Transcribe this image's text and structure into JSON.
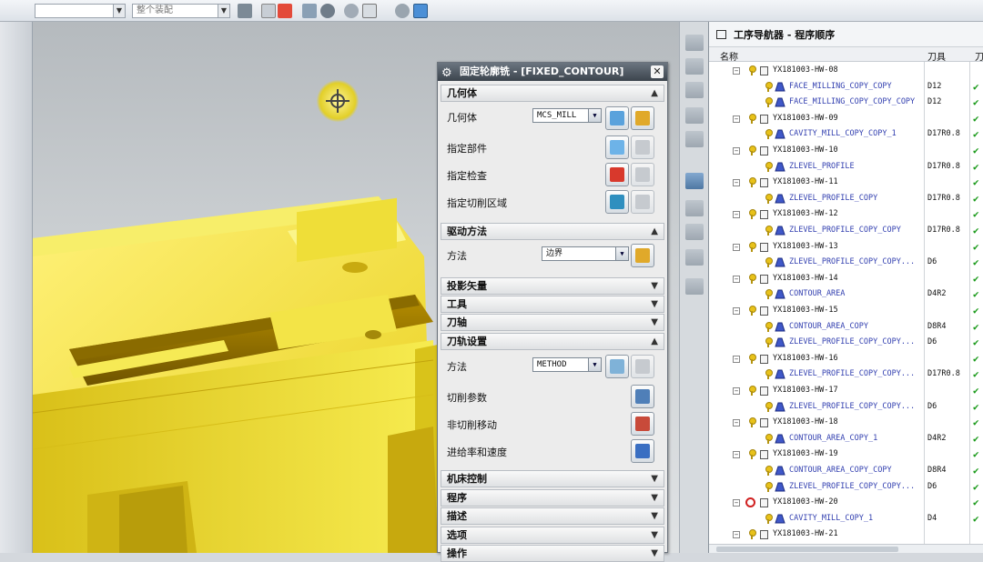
{
  "toolbar": {
    "select1": "",
    "select2": "整个装配"
  },
  "dialog": {
    "title": "固定轮廓铣 - [FIXED_CONTOUR]",
    "sections": {
      "geometry": "几何体",
      "drive": "驱动方法",
      "projection": "投影矢量",
      "tool": "工具",
      "axis": "刀轴",
      "path": "刀轨设置",
      "machine": "机床控制",
      "program": "程序",
      "description": "描述",
      "options": "选项",
      "actions": "操作"
    },
    "geometry_label": "几何体",
    "geometry_value": "MCS_MILL",
    "specify_part": "指定部件",
    "specify_check": "指定检查",
    "specify_cut_area": "指定切削区域",
    "method_label": "方法",
    "drive_method_value": "边界",
    "path_method_label": "方法",
    "path_method_value": "METHOD",
    "cut_params": "切削参数",
    "non_cut_moves": "非切削移动",
    "feeds_speeds": "进给率和速度"
  },
  "navigator": {
    "title": "工序导航器 - 程序顺序",
    "col_name": "名称",
    "col_tool": "刀具",
    "col_extra": "刀",
    "rows": [
      {
        "kind": "group",
        "label": "YX181003-HW-08",
        "tool": "",
        "check": ""
      },
      {
        "kind": "op",
        "label": "FACE_MILLING_COPY_COPY",
        "tool": "D12",
        "check": "✔"
      },
      {
        "kind": "op",
        "label": "FACE_MILLING_COPY_COPY_COPY",
        "tool": "D12",
        "check": "✔"
      },
      {
        "kind": "group",
        "label": "YX181003-HW-09",
        "tool": "",
        "check": "✔"
      },
      {
        "kind": "op",
        "label": "CAVITY_MILL_COPY_COPY_1",
        "tool": "D17R0.8",
        "check": "✔"
      },
      {
        "kind": "group",
        "label": "YX181003-HW-10",
        "tool": "",
        "check": "✔"
      },
      {
        "kind": "op",
        "label": "ZLEVEL_PROFILE",
        "tool": "D17R0.8",
        "check": "✔"
      },
      {
        "kind": "group",
        "label": "YX181003-HW-11",
        "tool": "",
        "check": "✔"
      },
      {
        "kind": "op",
        "label": "ZLEVEL_PROFILE_COPY",
        "tool": "D17R0.8",
        "check": "✔"
      },
      {
        "kind": "group",
        "label": "YX181003-HW-12",
        "tool": "",
        "check": "✔"
      },
      {
        "kind": "op",
        "label": "ZLEVEL_PROFILE_COPY_COPY",
        "tool": "D17R0.8",
        "check": "✔"
      },
      {
        "kind": "group",
        "label": "YX181003-HW-13",
        "tool": "",
        "check": "✔"
      },
      {
        "kind": "op",
        "label": "ZLEVEL_PROFILE_COPY_COPY...",
        "tool": "D6",
        "check": "✔"
      },
      {
        "kind": "group",
        "label": "YX181003-HW-14",
        "tool": "",
        "check": "✔"
      },
      {
        "kind": "op",
        "label": "CONTOUR_AREA",
        "tool": "D4R2",
        "check": "✔"
      },
      {
        "kind": "group",
        "label": "YX181003-HW-15",
        "tool": "",
        "check": "✔"
      },
      {
        "kind": "op",
        "label": "CONTOUR_AREA_COPY",
        "tool": "D8R4",
        "check": "✔"
      },
      {
        "kind": "op",
        "label": "ZLEVEL_PROFILE_COPY_COPY...",
        "tool": "D6",
        "check": "✔"
      },
      {
        "kind": "group",
        "label": "YX181003-HW-16",
        "tool": "",
        "check": "✔"
      },
      {
        "kind": "op",
        "label": "ZLEVEL_PROFILE_COPY_COPY...",
        "tool": "D17R0.8",
        "check": "✔"
      },
      {
        "kind": "group",
        "label": "YX181003-HW-17",
        "tool": "",
        "check": "✔"
      },
      {
        "kind": "op",
        "label": "ZLEVEL_PROFILE_COPY_COPY...",
        "tool": "D6",
        "check": "✔"
      },
      {
        "kind": "group",
        "label": "YX181003-HW-18",
        "tool": "",
        "check": "✔"
      },
      {
        "kind": "op",
        "label": "CONTOUR_AREA_COPY_1",
        "tool": "D4R2",
        "check": "✔"
      },
      {
        "kind": "group",
        "label": "YX181003-HW-19",
        "tool": "",
        "check": "✔"
      },
      {
        "kind": "op",
        "label": "CONTOUR_AREA_COPY_COPY",
        "tool": "D8R4",
        "check": "✔"
      },
      {
        "kind": "op",
        "label": "ZLEVEL_PROFILE_COPY_COPY...",
        "tool": "D6",
        "check": "✔"
      },
      {
        "kind": "group",
        "label": "YX181003-HW-20",
        "tool": "",
        "check": "✔",
        "blocked": true
      },
      {
        "kind": "op",
        "label": "CAVITY_MILL_COPY_1",
        "tool": "D4",
        "check": "✔"
      },
      {
        "kind": "group",
        "label": "YX181003-HW-21",
        "tool": "",
        "check": ""
      }
    ]
  },
  "colors": {
    "part": "#f1e23a",
    "accent": "#3340b0",
    "ok": "#1a9a1a"
  }
}
